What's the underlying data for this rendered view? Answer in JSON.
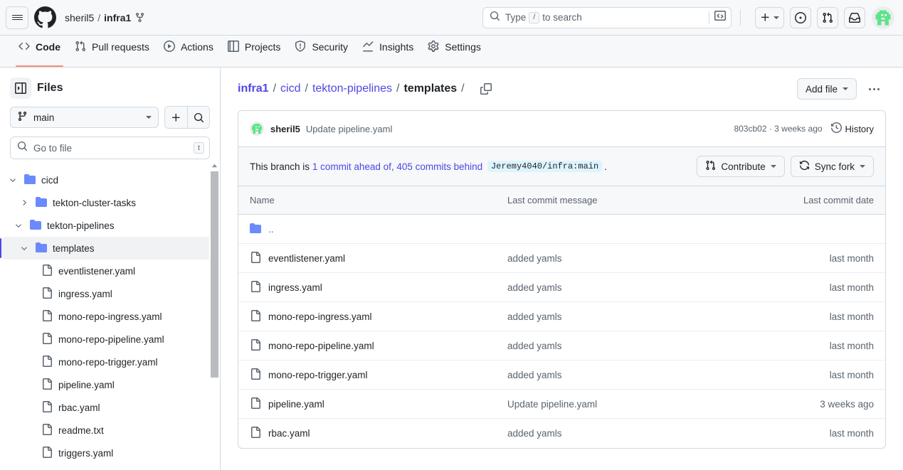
{
  "header": {
    "owner": "sheril5",
    "separator": "/",
    "repo": "infra1",
    "search_placeholder": "Type",
    "search_key": "/",
    "search_placeholder_tail": "to search"
  },
  "nav": {
    "tabs": [
      {
        "label": "Code",
        "icon": "code-icon",
        "active": true
      },
      {
        "label": "Pull requests",
        "icon": "git-pull-request-icon",
        "active": false
      },
      {
        "label": "Actions",
        "icon": "play-icon",
        "active": false
      },
      {
        "label": "Projects",
        "icon": "table-icon",
        "active": false
      },
      {
        "label": "Security",
        "icon": "shield-icon",
        "active": false
      },
      {
        "label": "Insights",
        "icon": "graph-icon",
        "active": false
      },
      {
        "label": "Settings",
        "icon": "gear-icon",
        "active": false
      }
    ]
  },
  "sidebar": {
    "title": "Files",
    "branch": "main",
    "go_to_file_placeholder": "Go to file",
    "go_to_file_key": "t",
    "tree": [
      {
        "label": "cicd",
        "type": "folder",
        "expanded": true,
        "depth": 0,
        "selected": false
      },
      {
        "label": "tekton-cluster-tasks",
        "type": "folder",
        "expanded": false,
        "depth": 1,
        "selected": false
      },
      {
        "label": "tekton-pipelines",
        "type": "folder",
        "expanded": true,
        "depth": 1,
        "selected": false
      },
      {
        "label": "templates",
        "type": "folder",
        "expanded": true,
        "depth": 2,
        "selected": true
      },
      {
        "label": "eventlistener.yaml",
        "type": "file",
        "depth": 3,
        "selected": false
      },
      {
        "label": "ingress.yaml",
        "type": "file",
        "depth": 3,
        "selected": false
      },
      {
        "label": "mono-repo-ingress.yaml",
        "type": "file",
        "depth": 3,
        "selected": false
      },
      {
        "label": "mono-repo-pipeline.yaml",
        "type": "file",
        "depth": 3,
        "selected": false
      },
      {
        "label": "mono-repo-trigger.yaml",
        "type": "file",
        "depth": 3,
        "selected": false
      },
      {
        "label": "pipeline.yaml",
        "type": "file",
        "depth": 3,
        "selected": false
      },
      {
        "label": "rbac.yaml",
        "type": "file",
        "depth": 3,
        "selected": false
      },
      {
        "label": "readme.txt",
        "type": "file",
        "depth": 3,
        "selected": false
      },
      {
        "label": "triggers.yaml",
        "type": "file",
        "depth": 3,
        "selected": false
      }
    ]
  },
  "main": {
    "breadcrumb": [
      {
        "label": "infra1",
        "link": true,
        "bold": true
      },
      {
        "label": "cicd",
        "link": true,
        "bold": false
      },
      {
        "label": "tekton-pipelines",
        "link": true,
        "bold": false
      },
      {
        "label": "templates",
        "link": false,
        "bold": true
      }
    ],
    "add_file_label": "Add file",
    "commit": {
      "author": "sheril5",
      "message": "Update pipeline.yaml",
      "sha_and_time": "803cb02 · 3 weeks ago",
      "history_label": "History"
    },
    "banner": {
      "prefix": "This branch is",
      "link": "1 commit ahead of, 405 commits behind",
      "chip": "Jeremy4040/infra:main",
      "suffix": ".",
      "contribute_label": "Contribute",
      "sync_label": "Sync fork"
    },
    "table": {
      "columns": [
        "Name",
        "Last commit message",
        "Last commit date"
      ],
      "rows": [
        {
          "name": "..",
          "type": "folder-parent",
          "message": "",
          "date": ""
        },
        {
          "name": "eventlistener.yaml",
          "type": "file",
          "message": "added yamls",
          "date": "last month"
        },
        {
          "name": "ingress.yaml",
          "type": "file",
          "message": "added yamls",
          "date": "last month"
        },
        {
          "name": "mono-repo-ingress.yaml",
          "type": "file",
          "message": "added yamls",
          "date": "last month"
        },
        {
          "name": "mono-repo-pipeline.yaml",
          "type": "file",
          "message": "added yamls",
          "date": "last month"
        },
        {
          "name": "mono-repo-trigger.yaml",
          "type": "file",
          "message": "added yamls",
          "date": "last month"
        },
        {
          "name": "pipeline.yaml",
          "type": "file",
          "message": "Update pipeline.yaml",
          "date": "3 weeks ago"
        },
        {
          "name": "rbac.yaml",
          "type": "file",
          "message": "added yamls",
          "date": "last month"
        }
      ]
    }
  },
  "colors": {
    "accent_link": "#4f46e5",
    "folder_blue": "#6b8afd",
    "active_tab_underline": "#fd8c73",
    "avatar_green": "#5fe38a",
    "chip_bg": "#ddf4ff"
  }
}
